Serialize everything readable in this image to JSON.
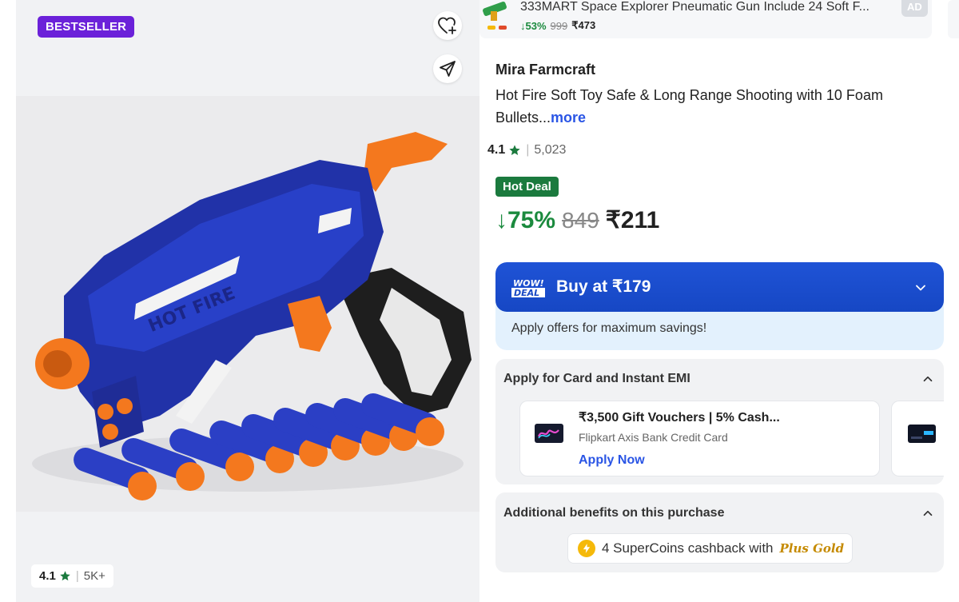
{
  "gallery": {
    "badge": "BESTSELLER",
    "rating": "4.1",
    "rating_count": "5K+"
  },
  "ad": {
    "title": "333MART Space Explorer Pneumatic Gun Include 24 Soft F...",
    "discount": "↓53%",
    "mrp": "999",
    "price": "₹473",
    "tag": "AD"
  },
  "product": {
    "brand": "Mira Farmcraft",
    "title": "Hot Fire Soft Toy Safe & Long Range Shooting with 10 Foam Bullets...",
    "more": "more",
    "rating": "4.1",
    "rating_count": "5,023",
    "deal_badge": "Hot Deal",
    "discount": "↓75%",
    "mrp": "849",
    "price": "₹211"
  },
  "wow_deal": {
    "logo_top": "WOW!",
    "logo_bottom": "DEAL",
    "label": "Buy at ₹179",
    "subtext": "Apply offers for maximum savings!"
  },
  "emi": {
    "heading": "Apply for Card and Instant EMI",
    "offer_title": "₹3,500 Gift Vouchers | 5% Cash...",
    "offer_bank": "Flipkart Axis Bank Credit Card",
    "offer_cta": "Apply Now"
  },
  "benefits": {
    "heading": "Additional benefits on this purchase",
    "supercoins_text": "4 SuperCoins cashback with",
    "plus_label": "Plus Gold"
  },
  "colors": {
    "bestseller": "#6b21d9",
    "discount_green": "#1b8a3e",
    "hot_deal": "#1b7a3e",
    "wow_blue": "#1f53d6",
    "link_blue": "#2a55e5",
    "star_green": "#1b7a3e",
    "plus_gold": "#c58a00"
  },
  "icons": {
    "wishlist": "heart-plus-icon",
    "share": "share-arrow-icon",
    "star": "star-icon",
    "chevron_down": "chevron-down-icon",
    "chevron_up": "chevron-up-icon",
    "supercoin": "supercoin-icon"
  }
}
